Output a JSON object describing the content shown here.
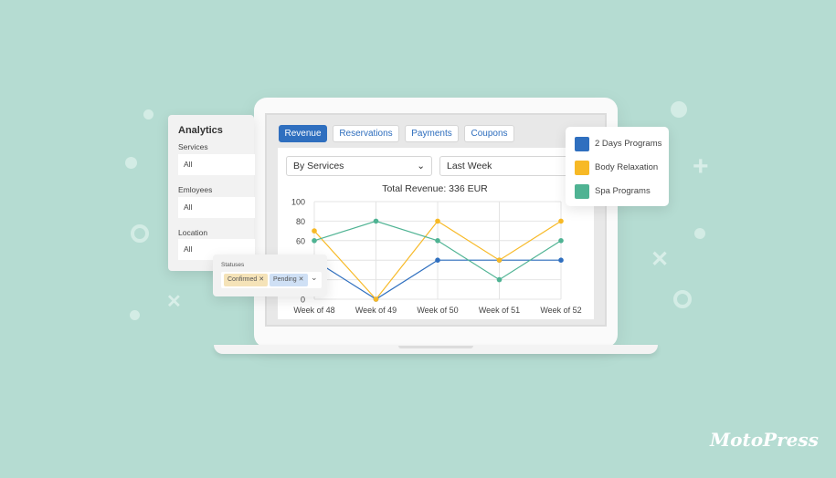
{
  "tabs": [
    {
      "label": "Revenue",
      "active": true
    },
    {
      "label": "Reservations"
    },
    {
      "label": "Payments"
    },
    {
      "label": "Coupons"
    }
  ],
  "filters": {
    "group_by": "By Services",
    "period": "Last Week"
  },
  "analytics": {
    "title": "Analytics",
    "services_label": "Services",
    "services_value": "All",
    "employees_label": "Emloyees",
    "employees_value": "All",
    "location_label": "Location",
    "location_value": "All"
  },
  "statuses": {
    "label": "Statuses",
    "chips": [
      "Confirmed",
      "Pending"
    ],
    "chip_colors": [
      "#f5e3b8",
      "#cfe0f5"
    ]
  },
  "brand": "MotoPress",
  "chart_data": {
    "type": "line",
    "title": "Total Revenue: 336 EUR",
    "categories": [
      "Week of 48",
      "Week of 49",
      "Week of 50",
      "Week of 51",
      "Week of 52"
    ],
    "yticks": [
      0,
      20,
      40,
      60,
      80,
      100
    ],
    "ylim": [
      0,
      100
    ],
    "grid": true,
    "legend_placement": "right",
    "series": [
      {
        "name": "2 Days Programs",
        "color": "#2f6fbf",
        "values": [
          40,
          0,
          40,
          40,
          40
        ]
      },
      {
        "name": "Body Relaxation",
        "color": "#f7b926",
        "values": [
          70,
          0,
          80,
          40,
          80
        ]
      },
      {
        "name": "Spa Programs",
        "color": "#4fb393",
        "values": [
          60,
          80,
          60,
          20,
          60
        ]
      }
    ]
  }
}
